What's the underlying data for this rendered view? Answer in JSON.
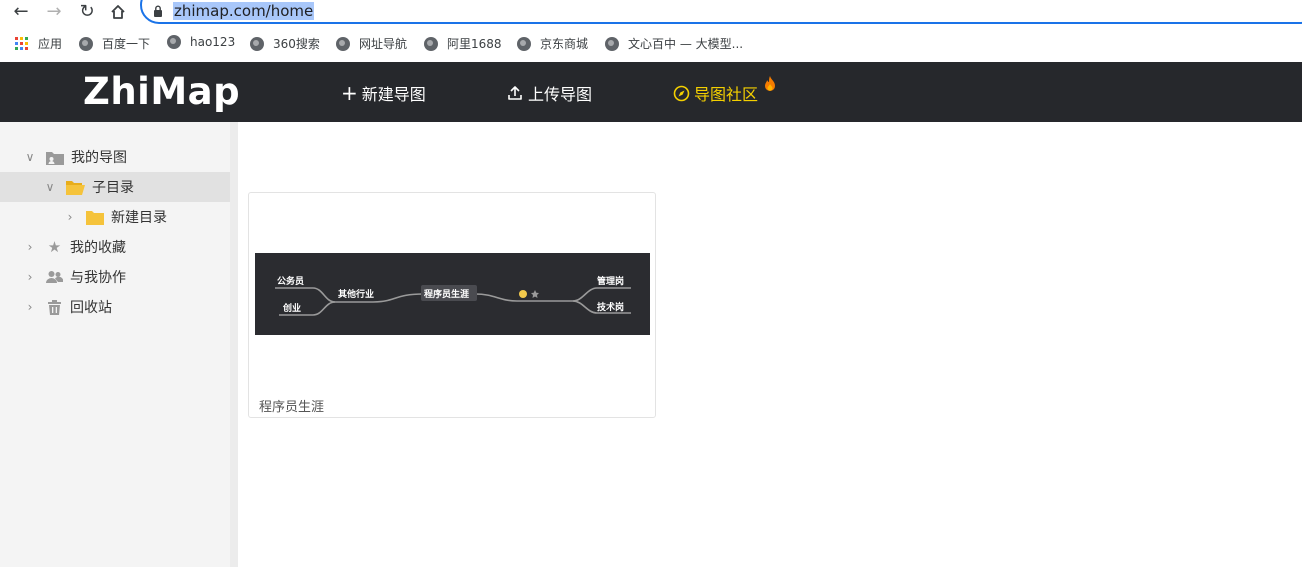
{
  "browser": {
    "url_host": "zhimap.com/home",
    "bookmarks": [
      {
        "label": "应用",
        "icon": "apps-grid-icon"
      },
      {
        "label": "百度一下",
        "icon": "globe-icon"
      },
      {
        "label": "hao123",
        "icon": "globe-icon"
      },
      {
        "label": "360搜索",
        "icon": "globe-icon"
      },
      {
        "label": "网址导航",
        "icon": "globe-icon"
      },
      {
        "label": "阿里1688",
        "icon": "globe-icon"
      },
      {
        "label": "京东商城",
        "icon": "globe-icon"
      },
      {
        "label": "文心百中 — 大模型...",
        "icon": "globe-icon"
      }
    ]
  },
  "header": {
    "logo": "ZhiMap",
    "menu": [
      {
        "label": "新建导图",
        "icon": "plus-icon"
      },
      {
        "label": "上传导图",
        "icon": "upload-icon"
      },
      {
        "label": "导图社区",
        "icon": "compass-icon"
      }
    ],
    "accent": "#f4d000"
  },
  "sidebar": {
    "items": [
      {
        "label": "我的导图",
        "icon": "user-folder-icon",
        "expanded": true
      },
      {
        "label": "子目录",
        "icon": "open-folder-icon",
        "expanded": true,
        "selected": true
      },
      {
        "label": "新建目录",
        "icon": "folder-icon",
        "expanded": false
      },
      {
        "label": "我的收藏",
        "icon": "star-icon",
        "expanded": false
      },
      {
        "label": "与我协作",
        "icon": "users-icon",
        "expanded": false
      },
      {
        "label": "回收站",
        "icon": "trash-icon",
        "expanded": false
      }
    ]
  },
  "main": {
    "cards": [
      {
        "title": "程序员生涯",
        "preview": {
          "center": "程序员生涯",
          "left_branch": "其他行业",
          "left_children": [
            "公务员",
            "创业"
          ],
          "right_children": [
            "管理岗",
            "技术岗"
          ]
        }
      }
    ]
  }
}
